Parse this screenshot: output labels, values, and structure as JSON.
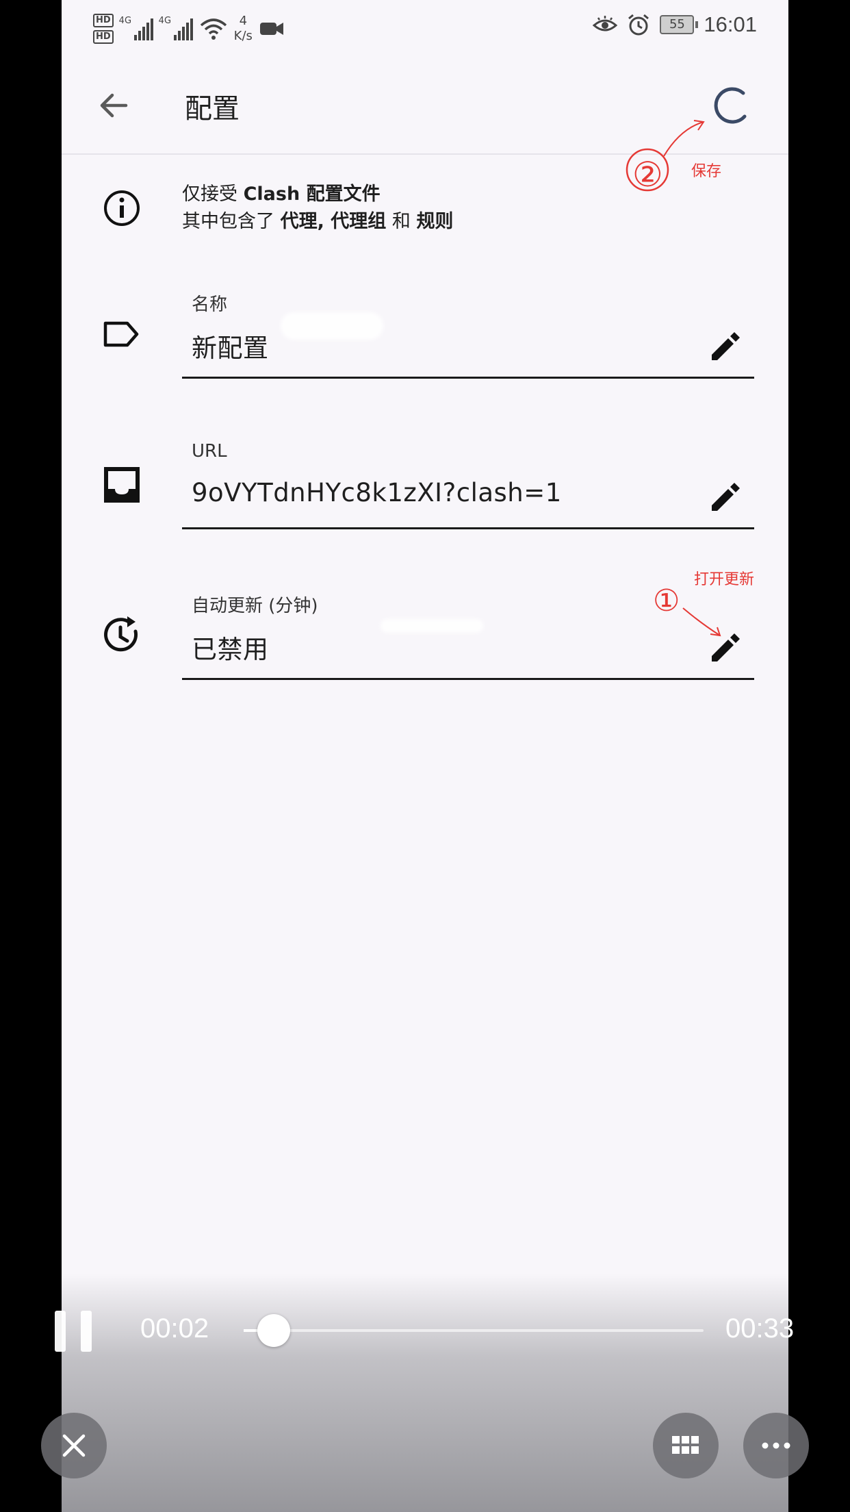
{
  "status_bar": {
    "hd1": "HD",
    "hd2": "HD",
    "net1": "4G",
    "net2": "4G",
    "speed_value": "4",
    "speed_unit": "K/s",
    "battery": "55",
    "time": "16:01",
    "icons": [
      "signal-icon",
      "wifi-icon",
      "video-record-icon",
      "eye-icon",
      "alarm-icon",
      "battery-icon"
    ]
  },
  "app_bar": {
    "title": "配置",
    "back_icon": "arrow-back-icon",
    "action_icon": "loading-spinner-icon"
  },
  "info": {
    "line1_prefix": "仅接受 ",
    "line1_bold": "Clash 配置文件",
    "line2_prefix": "其中包含了 ",
    "line2_bold1": "代理, 代理组",
    "line2_mid": " 和 ",
    "line2_bold2": "规则"
  },
  "fields": {
    "name": {
      "label": "名称",
      "value": "新配置",
      "icon": "label-tag-icon"
    },
    "url": {
      "label": "URL",
      "value": "9oVYTdnHYc8k1zXI?clash=1",
      "icon": "inbox-icon"
    },
    "auto_update": {
      "label": "自动更新 (分钟)",
      "value": "已禁用",
      "icon": "update-clock-icon"
    }
  },
  "annotations": {
    "save": "保存",
    "open_update": "打开更新",
    "step1": "①",
    "step2": "②"
  },
  "player": {
    "current_time": "00:02",
    "total_time": "00:33",
    "progress": 0.065
  },
  "colors": {
    "background": "#f8f6fa",
    "annotation": "#e53935",
    "spinner": "#3b4a66"
  }
}
